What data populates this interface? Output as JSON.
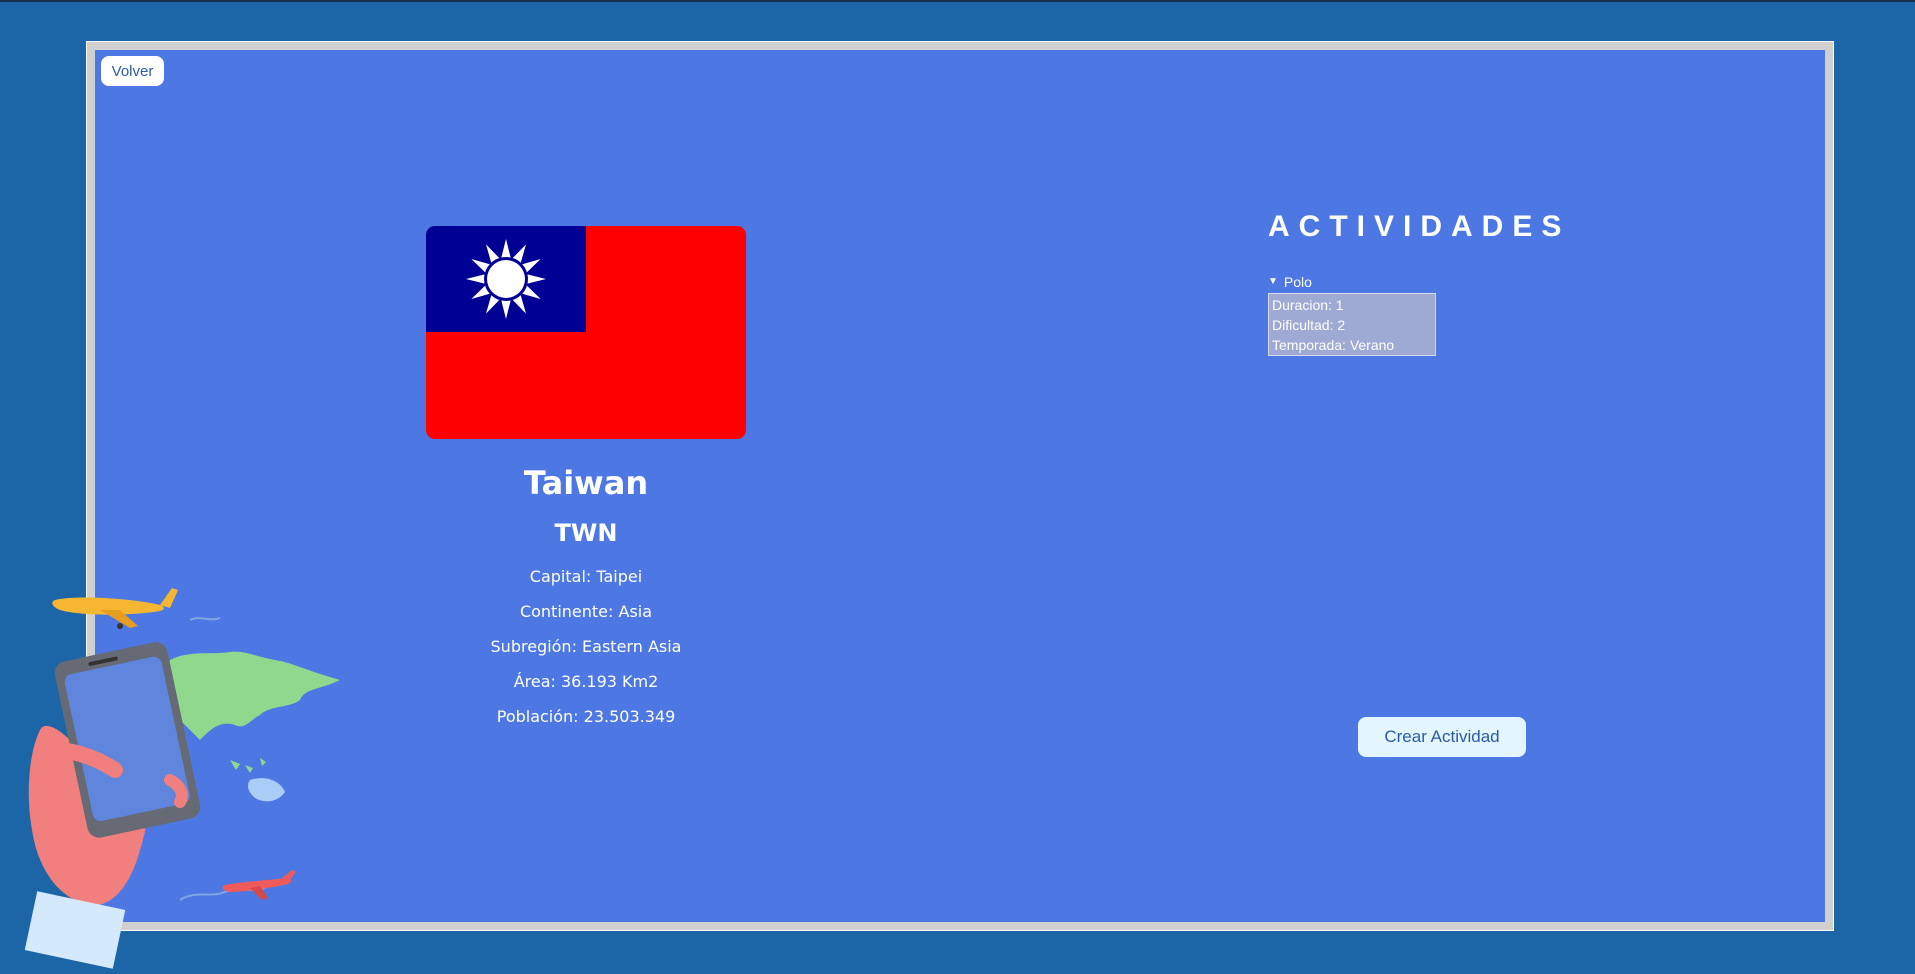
{
  "navigation": {
    "back_label": "Volver"
  },
  "country": {
    "name": "Taiwan",
    "code": "TWN",
    "details": [
      "Capital: Taipei",
      "Continente: Asia",
      "Subregión: Eastern Asia",
      "Área: 36.193 Km2",
      "Población: 23.503.349"
    ]
  },
  "activities": {
    "title": "ACTIVIDADES",
    "items": [
      {
        "name": "Polo",
        "expanded": true,
        "lines": [
          "Duracion: 1",
          "Dificultad: 2",
          "Temporada: Verano"
        ]
      }
    ],
    "create_label": "Crear Actividad"
  },
  "colors": {
    "page_background": "#1c66a8",
    "panel_background": "#4d78e3",
    "flag_red": "#fe0000",
    "flag_blue": "#000095",
    "button_text": "#2b5aa7"
  }
}
